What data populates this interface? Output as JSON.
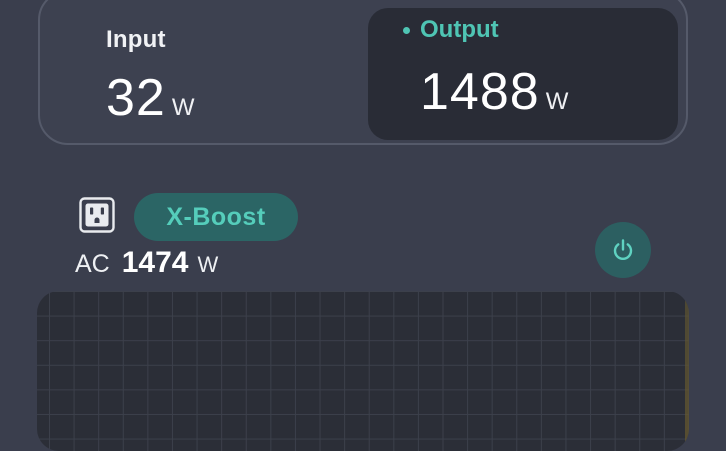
{
  "summary": {
    "input": {
      "label": "Input",
      "value": "32",
      "unit": "W"
    },
    "output": {
      "label": "Output",
      "value": "1488",
      "unit": "W",
      "active": true
    }
  },
  "ac": {
    "label": "AC",
    "value": "1474",
    "unit": "W",
    "xboost_label": "X-Boost",
    "outlet_icon": "ac-outlet-icon",
    "toggle_icon": "power-icon",
    "enabled": true
  },
  "colors": {
    "background": "#3a3e4d",
    "accent": "#4fc5b4",
    "panel_dark": "#292c36",
    "button_bg": "#2b6565"
  }
}
